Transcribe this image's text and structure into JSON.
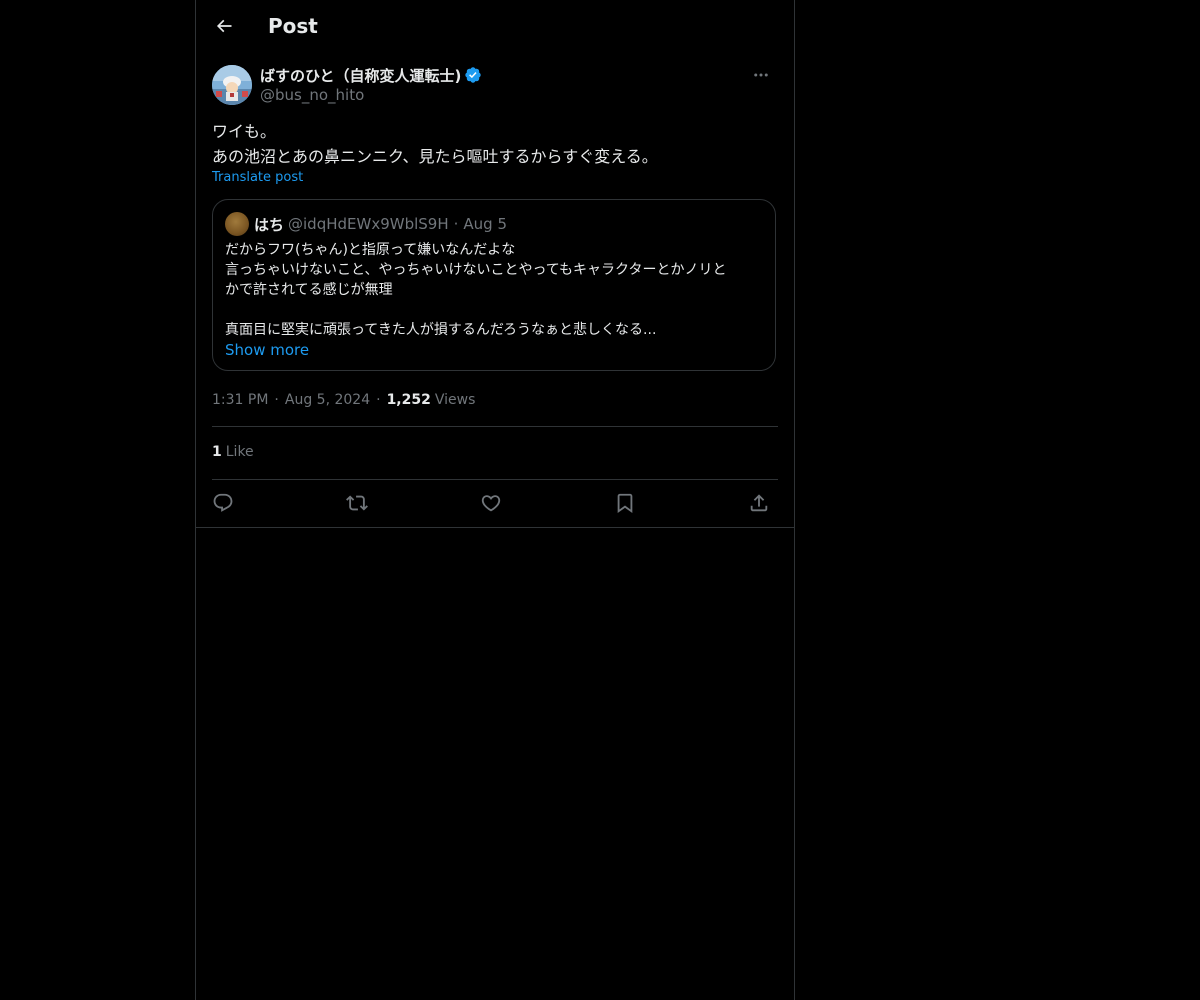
{
  "header": {
    "title": "Post"
  },
  "post": {
    "author": {
      "name": "ばすのひと（自称変人運転士)",
      "handle": "@bus_no_hito",
      "verified": true
    },
    "text_lines": [
      "ワイも。",
      "あの池沼とあの鼻ニンニク、見たら嘔吐するからすぐ変える。"
    ],
    "translate_label": "Translate post",
    "quote": {
      "name": "はち",
      "handle": "@idqHdEWx9WblS9H",
      "separator": "·",
      "date": "Aug 5",
      "lines": [
        "だからフワ(ちゃん)と指原って嫌いなんだよな",
        "言っちゃいけないこと、やっちゃいけないことやってもキャラクターとかノリと",
        "かで許されてる感じが無理",
        "",
        "真面目に堅実に頑張ってきた人が損するんだろうなぁと悲しくなる..."
      ],
      "show_more": "Show more"
    },
    "meta": {
      "time": "1:31 PM",
      "separator": "·",
      "date": "Aug 5, 2024",
      "views_count": "1,252",
      "views_label": "Views"
    },
    "likes": {
      "count": "1",
      "label": "Like"
    }
  },
  "actions": [
    "reply-icon",
    "repost-icon",
    "like-icon",
    "bookmark-icon",
    "share-icon"
  ],
  "colors": {
    "background": "#000000",
    "text": "#e7e9ea",
    "secondary": "#71767b",
    "accent": "#1d9bf0",
    "border": "#2f3336"
  }
}
